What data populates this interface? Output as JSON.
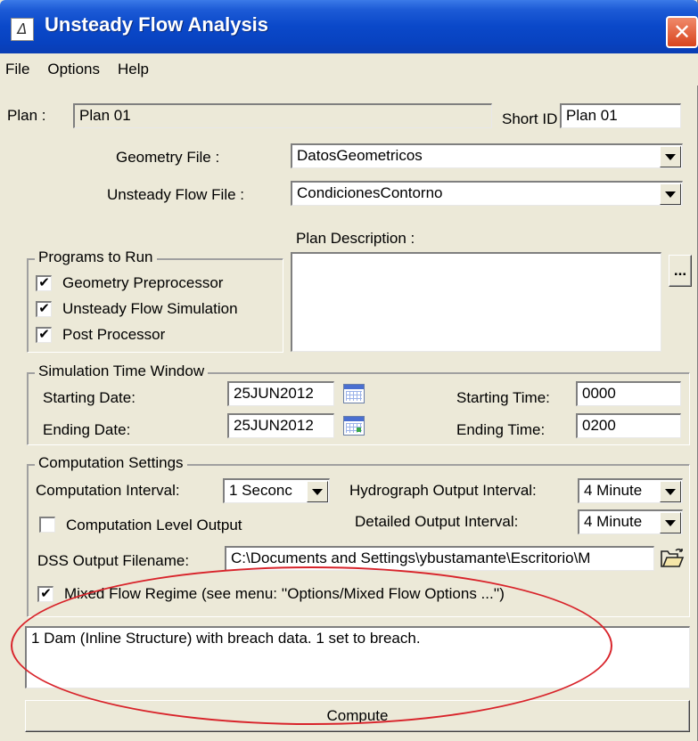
{
  "window": {
    "title": "Unsteady Flow Analysis",
    "close_glyph": "✕"
  },
  "menu": [
    "File",
    "Options",
    "Help"
  ],
  "plan": {
    "label": "Plan :",
    "value": "Plan 01",
    "short_id_label": "Short ID",
    "short_id_value": "Plan 01"
  },
  "geometry_file": {
    "label": "Geometry File :",
    "value": "DatosGeometricos"
  },
  "unsteady_flow_file": {
    "label": "Unsteady Flow File :",
    "value": "CondicionesContorno"
  },
  "plan_description": {
    "label": "Plan Description :",
    "value": "",
    "button": "..."
  },
  "programs": {
    "title": "Programs to Run",
    "items": [
      {
        "label": "Geometry Preprocessor",
        "checked": true
      },
      {
        "label": "Unsteady Flow Simulation",
        "checked": true
      },
      {
        "label": "Post Processor",
        "checked": true
      }
    ]
  },
  "simulation": {
    "title": "Simulation Time Window",
    "starting_date_label": "Starting Date:",
    "starting_date": "25JUN2012",
    "ending_date_label": "Ending Date:",
    "ending_date": "25JUN2012",
    "starting_time_label": "Starting Time:",
    "starting_time": "0000",
    "ending_time_label": "Ending Time:",
    "ending_time": "0200"
  },
  "computation": {
    "title": "Computation Settings",
    "interval_label": "Computation Interval:",
    "interval_value": "1 Seconc",
    "hydrograph_label": "Hydrograph Output Interval:",
    "hydrograph_value": "4 Minute",
    "level_output_label": "Computation Level Output",
    "level_output_checked": false,
    "detailed_label": "Detailed Output Interval:",
    "detailed_value": "4 Minute",
    "dss_label": "DSS Output Filename:",
    "dss_value": "C:\\Documents and Settings\\ybustamante\\Escritorio\\M",
    "mixed_flow_label": "Mixed Flow Regime (see menu: ''Options/Mixed Flow Options ...'')",
    "mixed_flow_checked": true
  },
  "status_message": "1 Dam (Inline Structure) with breach data. 1 set to breach.",
  "compute_button": "Compute",
  "check_glyph": "✔",
  "colors": {
    "title_blue": "#0a48c9",
    "window_bg": "#ece9d8",
    "annotation_red": "#d8232a"
  }
}
